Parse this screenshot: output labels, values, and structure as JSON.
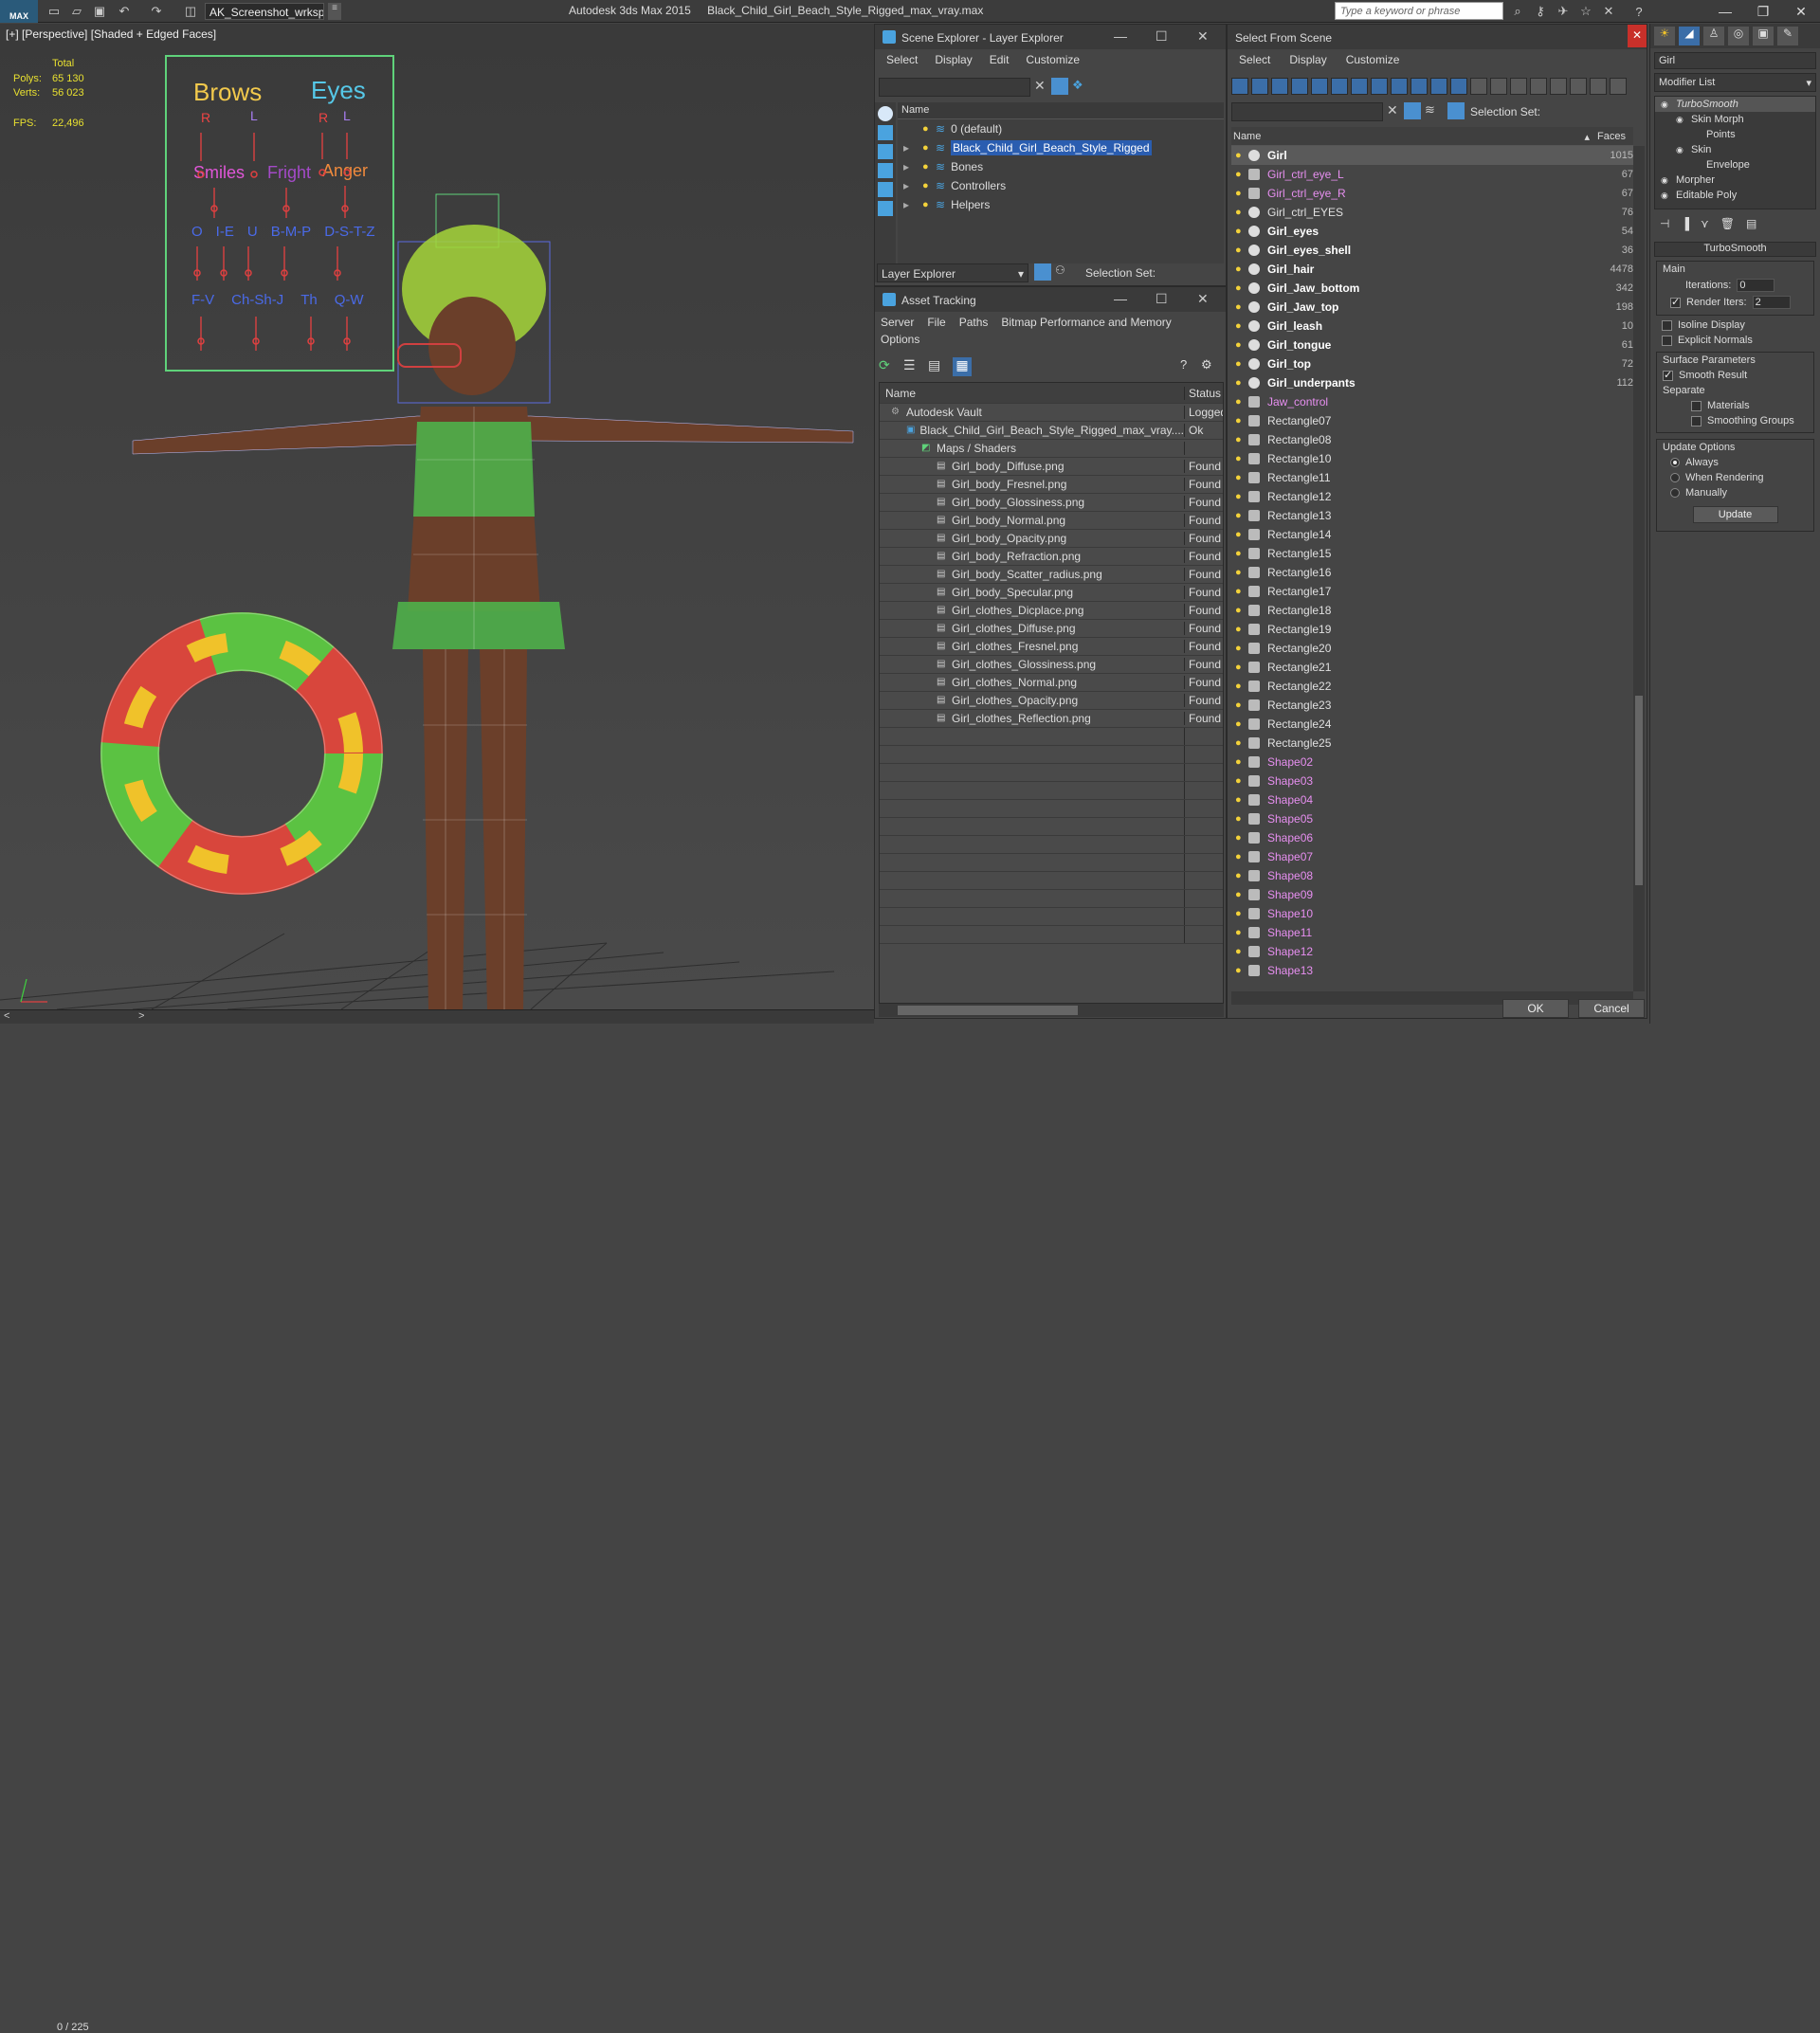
{
  "titlebar": {
    "logo": "MAX",
    "workspace": "AK_Screenshot_wrksp",
    "app": "Autodesk 3ds Max 2015",
    "file": "Black_Child_Girl_Beach_Style_Rigged_max_vray.max",
    "search_placeholder": "Type a keyword or phrase"
  },
  "viewport": {
    "label": "[+] [Perspective] [Shaded + Edged Faces]",
    "stats": {
      "total_label": "Total",
      "polys_label": "Polys:",
      "polys": "65 130",
      "verts_label": "Verts:",
      "verts": "56 023",
      "fps_label": "FPS:",
      "fps": "22,496"
    },
    "frame_counter": "0 / 225",
    "rig_board": {
      "brows": "Brows",
      "eyes": "Eyes",
      "r": "R",
      "l": "L",
      "smiles": "Smiles",
      "fright": "Fright",
      "anger": "Anger",
      "visemes1": [
        "O",
        "I-E",
        "U",
        "B-M-P",
        "D-S-T-Z"
      ],
      "visemes2": [
        "F-V",
        "Ch-Sh-J",
        "Th",
        "Q-W"
      ]
    }
  },
  "scene_explorer": {
    "title": "Scene Explorer - Layer Explorer",
    "menu": [
      "Select",
      "Display",
      "Edit",
      "Customize"
    ],
    "col_name": "Name",
    "layers": [
      "0 (default)",
      "Black_Child_Girl_Beach_Style_Rigged",
      "Bones",
      "Controllers",
      "Helpers"
    ],
    "footer_mode": "Layer Explorer",
    "footer_selset": "Selection Set:"
  },
  "asset_tracking": {
    "title": "Asset Tracking",
    "menu": [
      "Server",
      "File",
      "Paths",
      "Bitmap Performance and Memory"
    ],
    "menu2": "Options",
    "col_name": "Name",
    "col_status": "Status",
    "rows": [
      {
        "name": "Autodesk Vault",
        "status": "Logged",
        "indent": 0
      },
      {
        "name": "Black_Child_Girl_Beach_Style_Rigged_max_vray....",
        "status": "Ok",
        "indent": 1
      },
      {
        "name": "Maps / Shaders",
        "status": "",
        "indent": 2
      },
      {
        "name": "Girl_body_Diffuse.png",
        "status": "Found",
        "indent": 3
      },
      {
        "name": "Girl_body_Fresnel.png",
        "status": "Found",
        "indent": 3
      },
      {
        "name": "Girl_body_Glossiness.png",
        "status": "Found",
        "indent": 3
      },
      {
        "name": "Girl_body_Normal.png",
        "status": "Found",
        "indent": 3
      },
      {
        "name": "Girl_body_Opacity.png",
        "status": "Found",
        "indent": 3
      },
      {
        "name": "Girl_body_Refraction.png",
        "status": "Found",
        "indent": 3
      },
      {
        "name": "Girl_body_Scatter_radius.png",
        "status": "Found",
        "indent": 3
      },
      {
        "name": "Girl_body_Specular.png",
        "status": "Found",
        "indent": 3
      },
      {
        "name": "Girl_clothes_Dicplace.png",
        "status": "Found",
        "indent": 3
      },
      {
        "name": "Girl_clothes_Diffuse.png",
        "status": "Found",
        "indent": 3
      },
      {
        "name": "Girl_clothes_Fresnel.png",
        "status": "Found",
        "indent": 3
      },
      {
        "name": "Girl_clothes_Glossiness.png",
        "status": "Found",
        "indent": 3
      },
      {
        "name": "Girl_clothes_Normal.png",
        "status": "Found",
        "indent": 3
      },
      {
        "name": "Girl_clothes_Opacity.png",
        "status": "Found",
        "indent": 3
      },
      {
        "name": "Girl_clothes_Reflection.png",
        "status": "Found",
        "indent": 3
      }
    ]
  },
  "select_from_scene": {
    "title": "Select From Scene",
    "menu": [
      "Select",
      "Display",
      "Customize"
    ],
    "selset": "Selection Set:",
    "col_name": "Name",
    "col_faces": "Faces",
    "objects": [
      {
        "name": "Girl",
        "faces": "1015",
        "bold": true,
        "color": "#ffffff",
        "selected": true
      },
      {
        "name": "Girl_ctrl_eye_L",
        "faces": "67",
        "bold": false,
        "color": "#e78ff0"
      },
      {
        "name": "Girl_ctrl_eye_R",
        "faces": "67",
        "bold": false,
        "color": "#e78ff0"
      },
      {
        "name": "Girl_ctrl_EYES",
        "faces": "76",
        "bold": false,
        "color": "#e0e0e0"
      },
      {
        "name": "Girl_eyes",
        "faces": "54",
        "bold": true,
        "color": "#ffffff"
      },
      {
        "name": "Girl_eyes_shell",
        "faces": "36",
        "bold": true,
        "color": "#ffffff"
      },
      {
        "name": "Girl_hair",
        "faces": "4478",
        "bold": true,
        "color": "#ffffff"
      },
      {
        "name": "Girl_Jaw_bottom",
        "faces": "342",
        "bold": true,
        "color": "#ffffff"
      },
      {
        "name": "Girl_Jaw_top",
        "faces": "198",
        "bold": true,
        "color": "#ffffff"
      },
      {
        "name": "Girl_leash",
        "faces": "10",
        "bold": true,
        "color": "#ffffff"
      },
      {
        "name": "Girl_tongue",
        "faces": "61",
        "bold": true,
        "color": "#ffffff"
      },
      {
        "name": "Girl_top",
        "faces": "72",
        "bold": true,
        "color": "#ffffff"
      },
      {
        "name": "Girl_underpants",
        "faces": "112",
        "bold": true,
        "color": "#ffffff"
      },
      {
        "name": "Jaw_control",
        "faces": "",
        "bold": false,
        "color": "#e78ff0"
      },
      {
        "name": "Rectangle07",
        "faces": "",
        "bold": false,
        "color": "#e0e0e0"
      },
      {
        "name": "Rectangle08",
        "faces": "",
        "bold": false,
        "color": "#e0e0e0"
      },
      {
        "name": "Rectangle10",
        "faces": "",
        "bold": false,
        "color": "#e0e0e0"
      },
      {
        "name": "Rectangle11",
        "faces": "",
        "bold": false,
        "color": "#e0e0e0"
      },
      {
        "name": "Rectangle12",
        "faces": "",
        "bold": false,
        "color": "#e0e0e0"
      },
      {
        "name": "Rectangle13",
        "faces": "",
        "bold": false,
        "color": "#e0e0e0"
      },
      {
        "name": "Rectangle14",
        "faces": "",
        "bold": false,
        "color": "#e0e0e0"
      },
      {
        "name": "Rectangle15",
        "faces": "",
        "bold": false,
        "color": "#e0e0e0"
      },
      {
        "name": "Rectangle16",
        "faces": "",
        "bold": false,
        "color": "#e0e0e0"
      },
      {
        "name": "Rectangle17",
        "faces": "",
        "bold": false,
        "color": "#e0e0e0"
      },
      {
        "name": "Rectangle18",
        "faces": "",
        "bold": false,
        "color": "#e0e0e0"
      },
      {
        "name": "Rectangle19",
        "faces": "",
        "bold": false,
        "color": "#e0e0e0"
      },
      {
        "name": "Rectangle20",
        "faces": "",
        "bold": false,
        "color": "#e0e0e0"
      },
      {
        "name": "Rectangle21",
        "faces": "",
        "bold": false,
        "color": "#e0e0e0"
      },
      {
        "name": "Rectangle22",
        "faces": "",
        "bold": false,
        "color": "#e0e0e0"
      },
      {
        "name": "Rectangle23",
        "faces": "",
        "bold": false,
        "color": "#e0e0e0"
      },
      {
        "name": "Rectangle24",
        "faces": "",
        "bold": false,
        "color": "#e0e0e0"
      },
      {
        "name": "Rectangle25",
        "faces": "",
        "bold": false,
        "color": "#e0e0e0"
      },
      {
        "name": "Shape02",
        "faces": "",
        "bold": false,
        "color": "#e78ff0"
      },
      {
        "name": "Shape03",
        "faces": "",
        "bold": false,
        "color": "#e78ff0"
      },
      {
        "name": "Shape04",
        "faces": "",
        "bold": false,
        "color": "#e78ff0"
      },
      {
        "name": "Shape05",
        "faces": "",
        "bold": false,
        "color": "#e78ff0"
      },
      {
        "name": "Shape06",
        "faces": "",
        "bold": false,
        "color": "#e78ff0"
      },
      {
        "name": "Shape07",
        "faces": "",
        "bold": false,
        "color": "#e78ff0"
      },
      {
        "name": "Shape08",
        "faces": "",
        "bold": false,
        "color": "#e78ff0"
      },
      {
        "name": "Shape09",
        "faces": "",
        "bold": false,
        "color": "#e78ff0"
      },
      {
        "name": "Shape10",
        "faces": "",
        "bold": false,
        "color": "#e78ff0"
      },
      {
        "name": "Shape11",
        "faces": "",
        "bold": false,
        "color": "#e78ff0"
      },
      {
        "name": "Shape12",
        "faces": "",
        "bold": false,
        "color": "#e78ff0"
      },
      {
        "name": "Shape13",
        "faces": "",
        "bold": false,
        "color": "#e78ff0"
      }
    ],
    "ok": "OK",
    "cancel": "Cancel"
  },
  "command_panel": {
    "name_field": "Girl",
    "modifier_list": "Modifier List",
    "stack": [
      {
        "name": "TurboSmooth",
        "indent": 0,
        "italic": true
      },
      {
        "name": "Skin Morph",
        "indent": 1,
        "italic": false
      },
      {
        "name": "Points",
        "indent": 2,
        "italic": false
      },
      {
        "name": "Skin",
        "indent": 1,
        "italic": false
      },
      {
        "name": "Envelope",
        "indent": 2,
        "italic": false
      },
      {
        "name": "Morpher",
        "indent": 0,
        "italic": false
      },
      {
        "name": "Editable Poly",
        "indent": 0,
        "italic": false
      }
    ],
    "rollout": "TurboSmooth",
    "main_label": "Main",
    "iterations_label": "Iterations:",
    "iterations": "0",
    "render_iters_label": "Render Iters:",
    "render_iters": "2",
    "isoline": "Isoline Display",
    "explicit_normals": "Explicit Normals",
    "surface_params": "Surface Parameters",
    "smooth_result": "Smooth Result",
    "separate": "Separate",
    "materials": "Materials",
    "smoothing_groups": "Smoothing Groups",
    "update_options": "Update Options",
    "always": "Always",
    "when_rendering": "When Rendering",
    "manually": "Manually",
    "update_btn": "Update"
  }
}
